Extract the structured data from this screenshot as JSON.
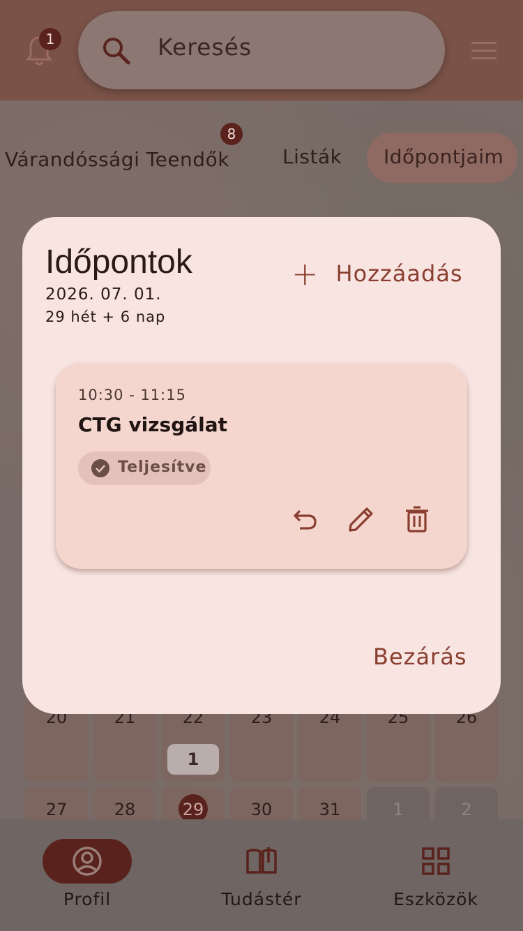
{
  "topbar": {
    "notification_count": "1",
    "search_placeholder": "Keresés"
  },
  "tabs": [
    {
      "label": "Várandóssági Teendők",
      "badge": "8"
    },
    {
      "label": "Listák"
    },
    {
      "label": "Időpontjaim",
      "active": true
    }
  ],
  "calendar": {
    "row1": [
      "20",
      "21",
      "22",
      "23",
      "24",
      "25",
      "26"
    ],
    "row2": [
      "27",
      "28",
      "29",
      "30",
      "31",
      "1",
      "2"
    ],
    "event_count_22": "1",
    "today": "29"
  },
  "dialog": {
    "title": "Időpontok",
    "date": "2026. 07. 01.",
    "week_info": "29 hét + 6 nap",
    "add_label": "Hozzáadás",
    "close_label": "Bezárás",
    "appointment": {
      "time": "10:30 - 11:15",
      "title": "CTG vizsgálat",
      "status": "Teljesítve"
    }
  },
  "bottom_nav": [
    {
      "label": "Profil",
      "icon": "account-circle-icon",
      "active": true
    },
    {
      "label": "Tudástér",
      "icon": "book-open-icon"
    },
    {
      "label": "Eszközök",
      "icon": "grid-icon"
    }
  ],
  "colors": {
    "accent": "#8a3e30",
    "dark_accent": "#5a221c",
    "dialog_bg": "#f8e5e2",
    "card_bg": "#f4d6ce"
  }
}
